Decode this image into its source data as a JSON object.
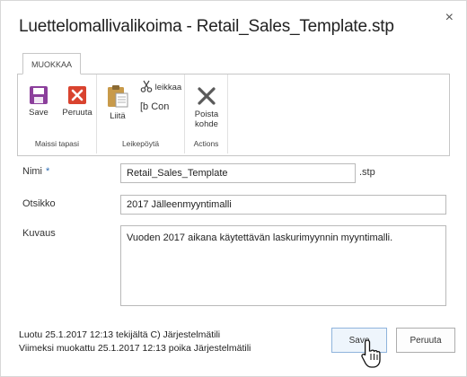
{
  "dialog": {
    "title": "Luettelomallivalikoima - Retail_Sales_Template.stp",
    "close": "×"
  },
  "ribbon": {
    "tab": "MUOKKAA",
    "groups": [
      {
        "label": "Maissi tapasi",
        "buttons": [
          {
            "label": "Save"
          },
          {
            "label": "Peruuta"
          }
        ]
      },
      {
        "label": "Leikepöytä",
        "buttons": [
          {
            "label": "Liitä"
          },
          {
            "label": "leikkaa"
          },
          {
            "label": "[b Con"
          }
        ]
      },
      {
        "label": "Actions",
        "buttons": [
          {
            "label_line1": "Poista",
            "label_line2": "kohde"
          }
        ]
      }
    ]
  },
  "form": {
    "name": {
      "label": "Nimi",
      "required_mark": "*",
      "value": "Retail_Sales_Template",
      "extension": ".stp"
    },
    "title": {
      "label": "Otsikko",
      "value": "2017 Jälleenmyyntimalli"
    },
    "description": {
      "label": "Kuvaus",
      "value": "Vuoden 2017 aikana käytettävän laskurimyynnin myyntimalli."
    }
  },
  "footer": {
    "created": "Luotu 25.1.2017 12:13 tekijältä C) Järjestelmätili",
    "modified": "Viimeksi muokattu 25.1.2017 12:13 poika Järjestelmätili",
    "save_label": "Save",
    "cancel_label": "Peruuta"
  },
  "colors": {
    "save_icon": "#8c3f9c",
    "cancel_icon": "#d9432f",
    "paste_icon": "#c89a4a",
    "primary_border": "#8fb4dc"
  }
}
